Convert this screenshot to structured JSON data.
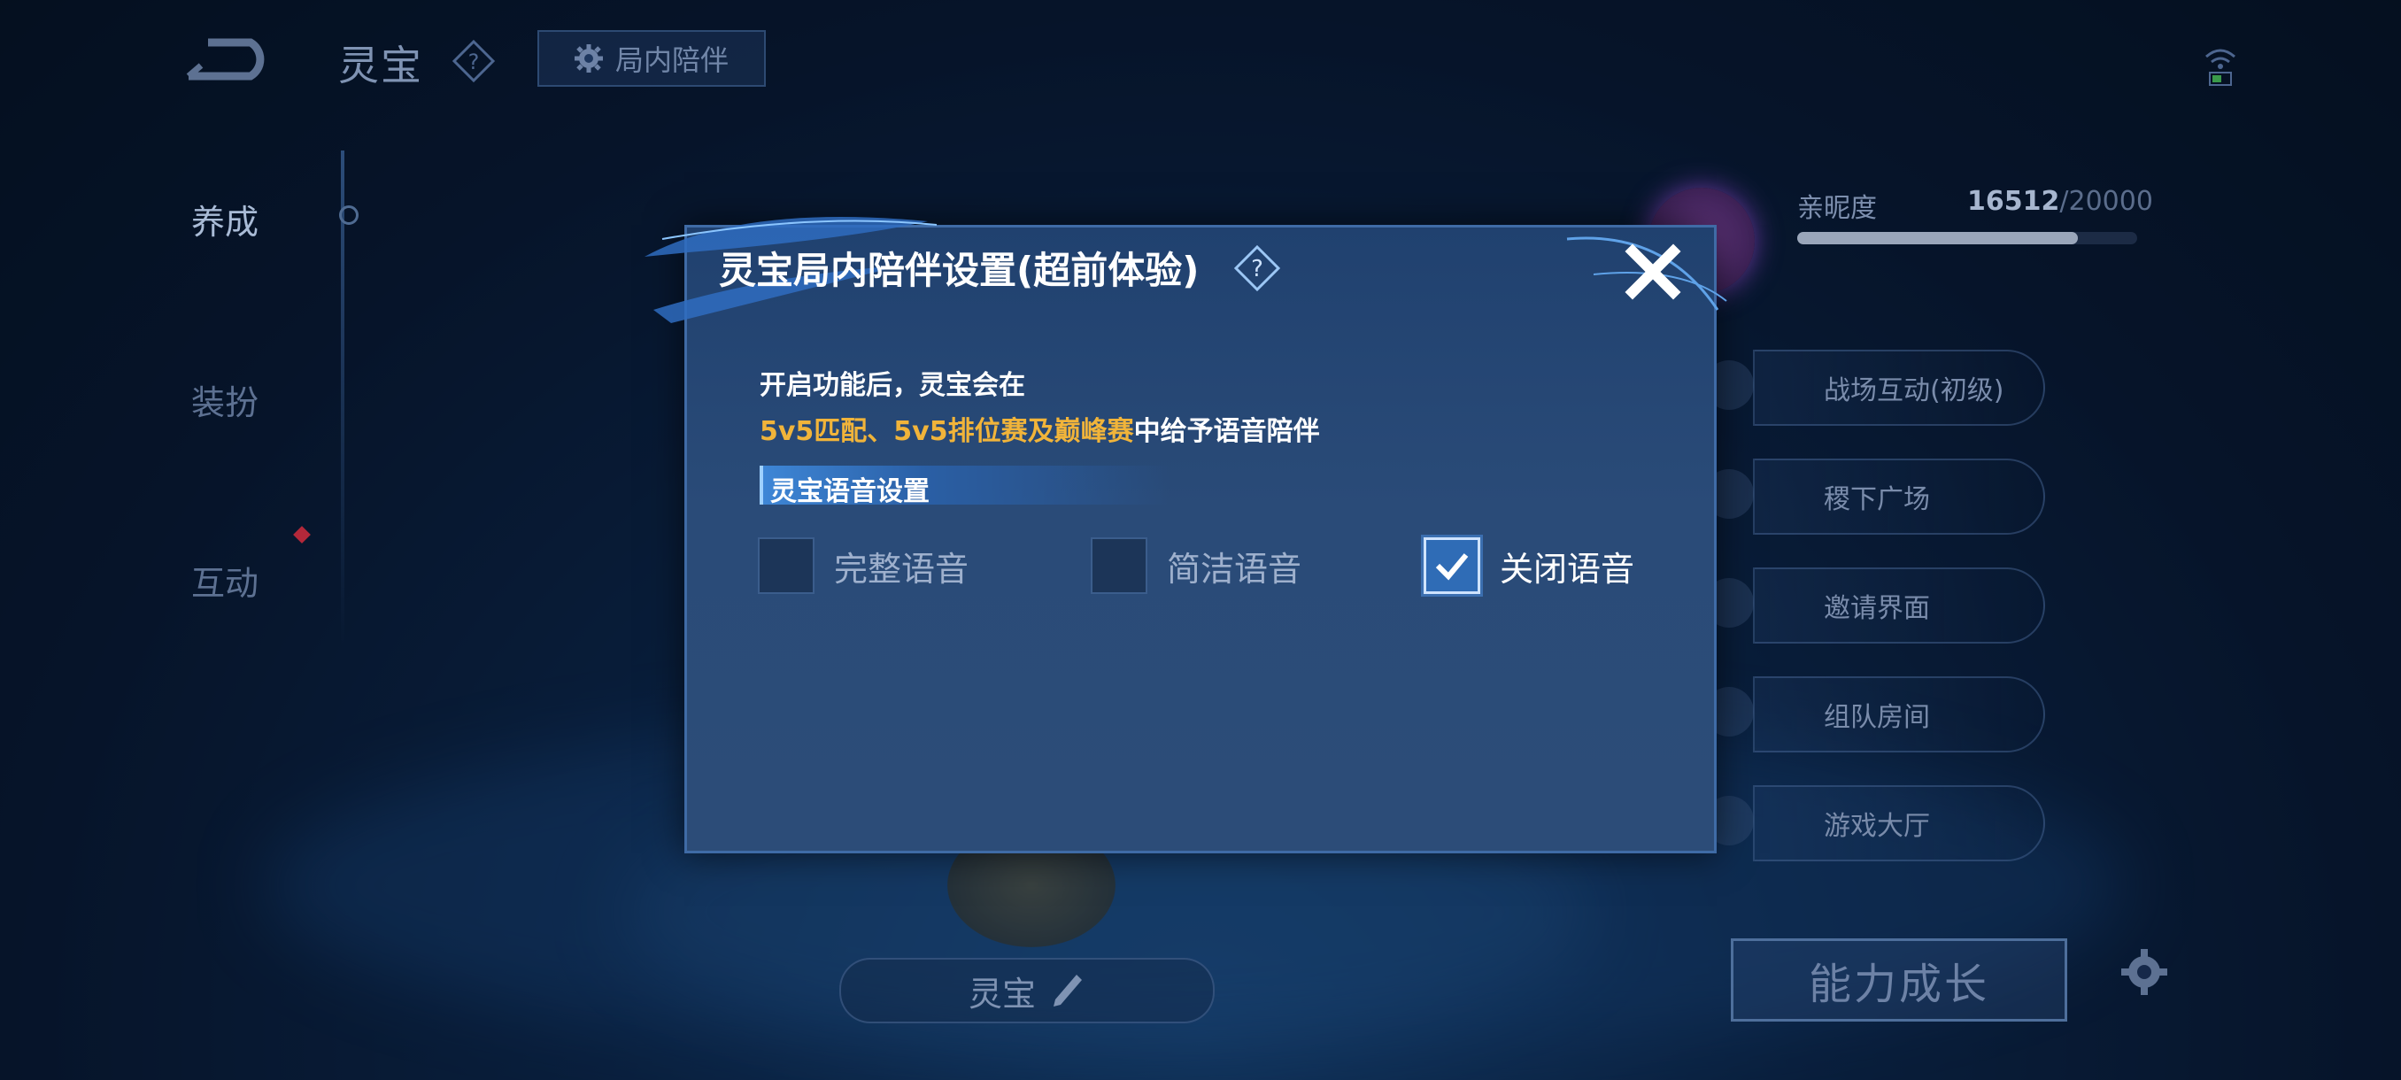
{
  "topbar": {
    "page_title": "灵宝",
    "companion_button": "局内陪伴"
  },
  "left_nav": {
    "items": [
      {
        "label": "养成",
        "active": true
      },
      {
        "label": "装扮",
        "active": false
      },
      {
        "label": "互动",
        "active": false
      }
    ]
  },
  "right_panel": {
    "intimacy_label": "亲昵度",
    "intimacy_current": "16512",
    "intimacy_max": "/20000",
    "intimacy_fraction": 0.8256,
    "scenes": [
      "战场互动(初级)",
      "稷下广场",
      "邀请界面",
      "组队房间",
      "游戏大厅"
    ],
    "growth_button": "能力成长"
  },
  "bottom": {
    "pet_name": "灵宝"
  },
  "dialog": {
    "title": "灵宝局内陪伴设置(超前体验)",
    "intro_line1": "开启功能后，灵宝会在",
    "intro_line2_highlight": "5v5匹配、5v5排位赛及巅峰赛",
    "intro_line2_rest": "中给予语音陪伴",
    "section_label": "灵宝语音设置",
    "options": [
      {
        "label": "完整语音",
        "checked": false
      },
      {
        "label": "简洁语音",
        "checked": false
      },
      {
        "label": "关闭语音",
        "checked": true
      }
    ]
  },
  "colors": {
    "highlight": "#f1b43a",
    "dialog_bg": "#2a4b78",
    "checkbox_checked": "#2f6cb6"
  }
}
